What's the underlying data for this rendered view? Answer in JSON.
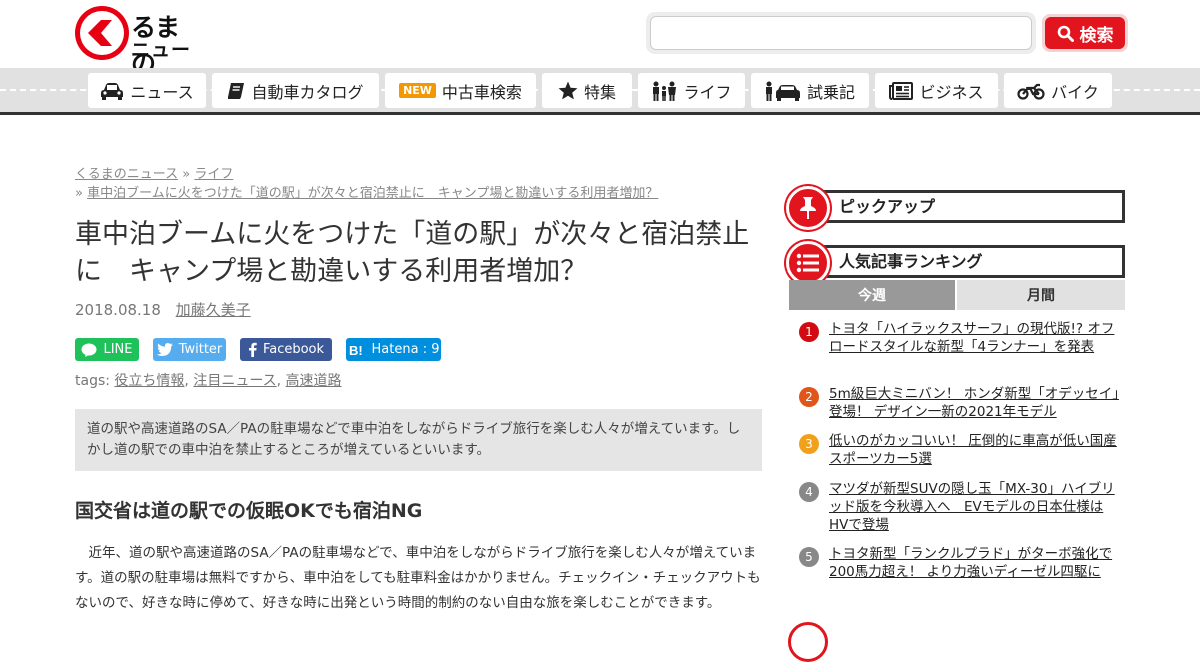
{
  "logo": {
    "line1": "るまの",
    "line2": "ニュース"
  },
  "search": {
    "placeholder": "",
    "button_label": "検索"
  },
  "nav": {
    "items": [
      {
        "label": "ニュース",
        "icon": "car-icon"
      },
      {
        "label": "自動車カタログ",
        "icon": "book-icon"
      },
      {
        "label": "中古車検索",
        "icon": "new-badge",
        "badge": "NEW"
      },
      {
        "label": "特集",
        "icon": "star-icon"
      },
      {
        "label": "ライフ",
        "icon": "family-icon"
      },
      {
        "label": "試乗記",
        "icon": "people-car-icon"
      },
      {
        "label": "ビジネス",
        "icon": "newspaper-icon"
      },
      {
        "label": "バイク",
        "icon": "motorcycle-icon"
      }
    ]
  },
  "breadcrumb": {
    "home": "くるまのニュース",
    "sep": "»",
    "category": "ライフ",
    "current": "車中泊ブームに火をつけた「道の駅」が次々と宿泊禁止に　キャンプ場と勘違いする利用者増加？"
  },
  "article": {
    "title": "車中泊ブームに火をつけた「道の駅」が次々と宿泊禁止に　キャンプ場と勘違いする利用者増加？",
    "date": "2018.08.18",
    "author": "加藤久美子",
    "share": {
      "line": "LINE",
      "twitter": "Twitter",
      "facebook": "Facebook",
      "hatena": "Hatena : 9"
    },
    "tags_label": "tags:",
    "tags": [
      "役立ち情報",
      "注目ニュース",
      "高速道路"
    ],
    "lead": "道の駅や高速道路のSA／PAの駐車場などで車中泊をしながらドライブ旅行を楽しむ人々が増えています。しかし道の駅での車中泊を禁止するところが増えているといいます。",
    "h2": "国交省は道の駅での仮眠OKでも宿泊NG",
    "body": "　近年、道の駅や高速道路のSA／PAの駐車場などで、車中泊をしながらドライブ旅行を楽しむ人々が増えています。道の駅の駐車場は無料ですから、車中泊をしても駐車料金はかかりません。チェックイン・チェックアウトもないので、好きな時に停めて、好きな時に出発という時間的制約のない自由な旅を楽しむことができます。"
  },
  "sidebar": {
    "pickup_title": "ピックアップ",
    "ranking_title": "人気記事ランキング",
    "tabs": [
      "今週",
      "月間"
    ],
    "ranking": [
      {
        "num": "1",
        "text": "トヨタ「ハイラックスサーフ」の現代版!? オフロードスタイルな新型「4ランナー」を発表",
        "color": "#d20a11"
      },
      {
        "num": "2",
        "text": "5m級巨大ミニバン！ ホンダ新型「オデッセイ」登場！ デザイン一新の2021年モデル",
        "color": "#e0561a"
      },
      {
        "num": "3",
        "text": "低いのがカッコいい！ 圧倒的に車高が低い国産スポーツカー5選",
        "color": "#f0a01a"
      },
      {
        "num": "4",
        "text": "マツダが新型SUVの隠し玉「MX-30」ハイブリッド版を今秋導入へ　EVモデルの日本仕様はHVで登場",
        "color": "#888888"
      },
      {
        "num": "5",
        "text": "トヨタ新型「ランクルプラド」がターボ強化で200馬力超え！ より力強いディーゼル四駆に",
        "color": "#888888"
      }
    ]
  },
  "colors": {
    "brand": "#e2141e",
    "line": "#1fc15b",
    "twitter": "#55acee",
    "facebook": "#3b5998",
    "hatena": "#008fde"
  }
}
